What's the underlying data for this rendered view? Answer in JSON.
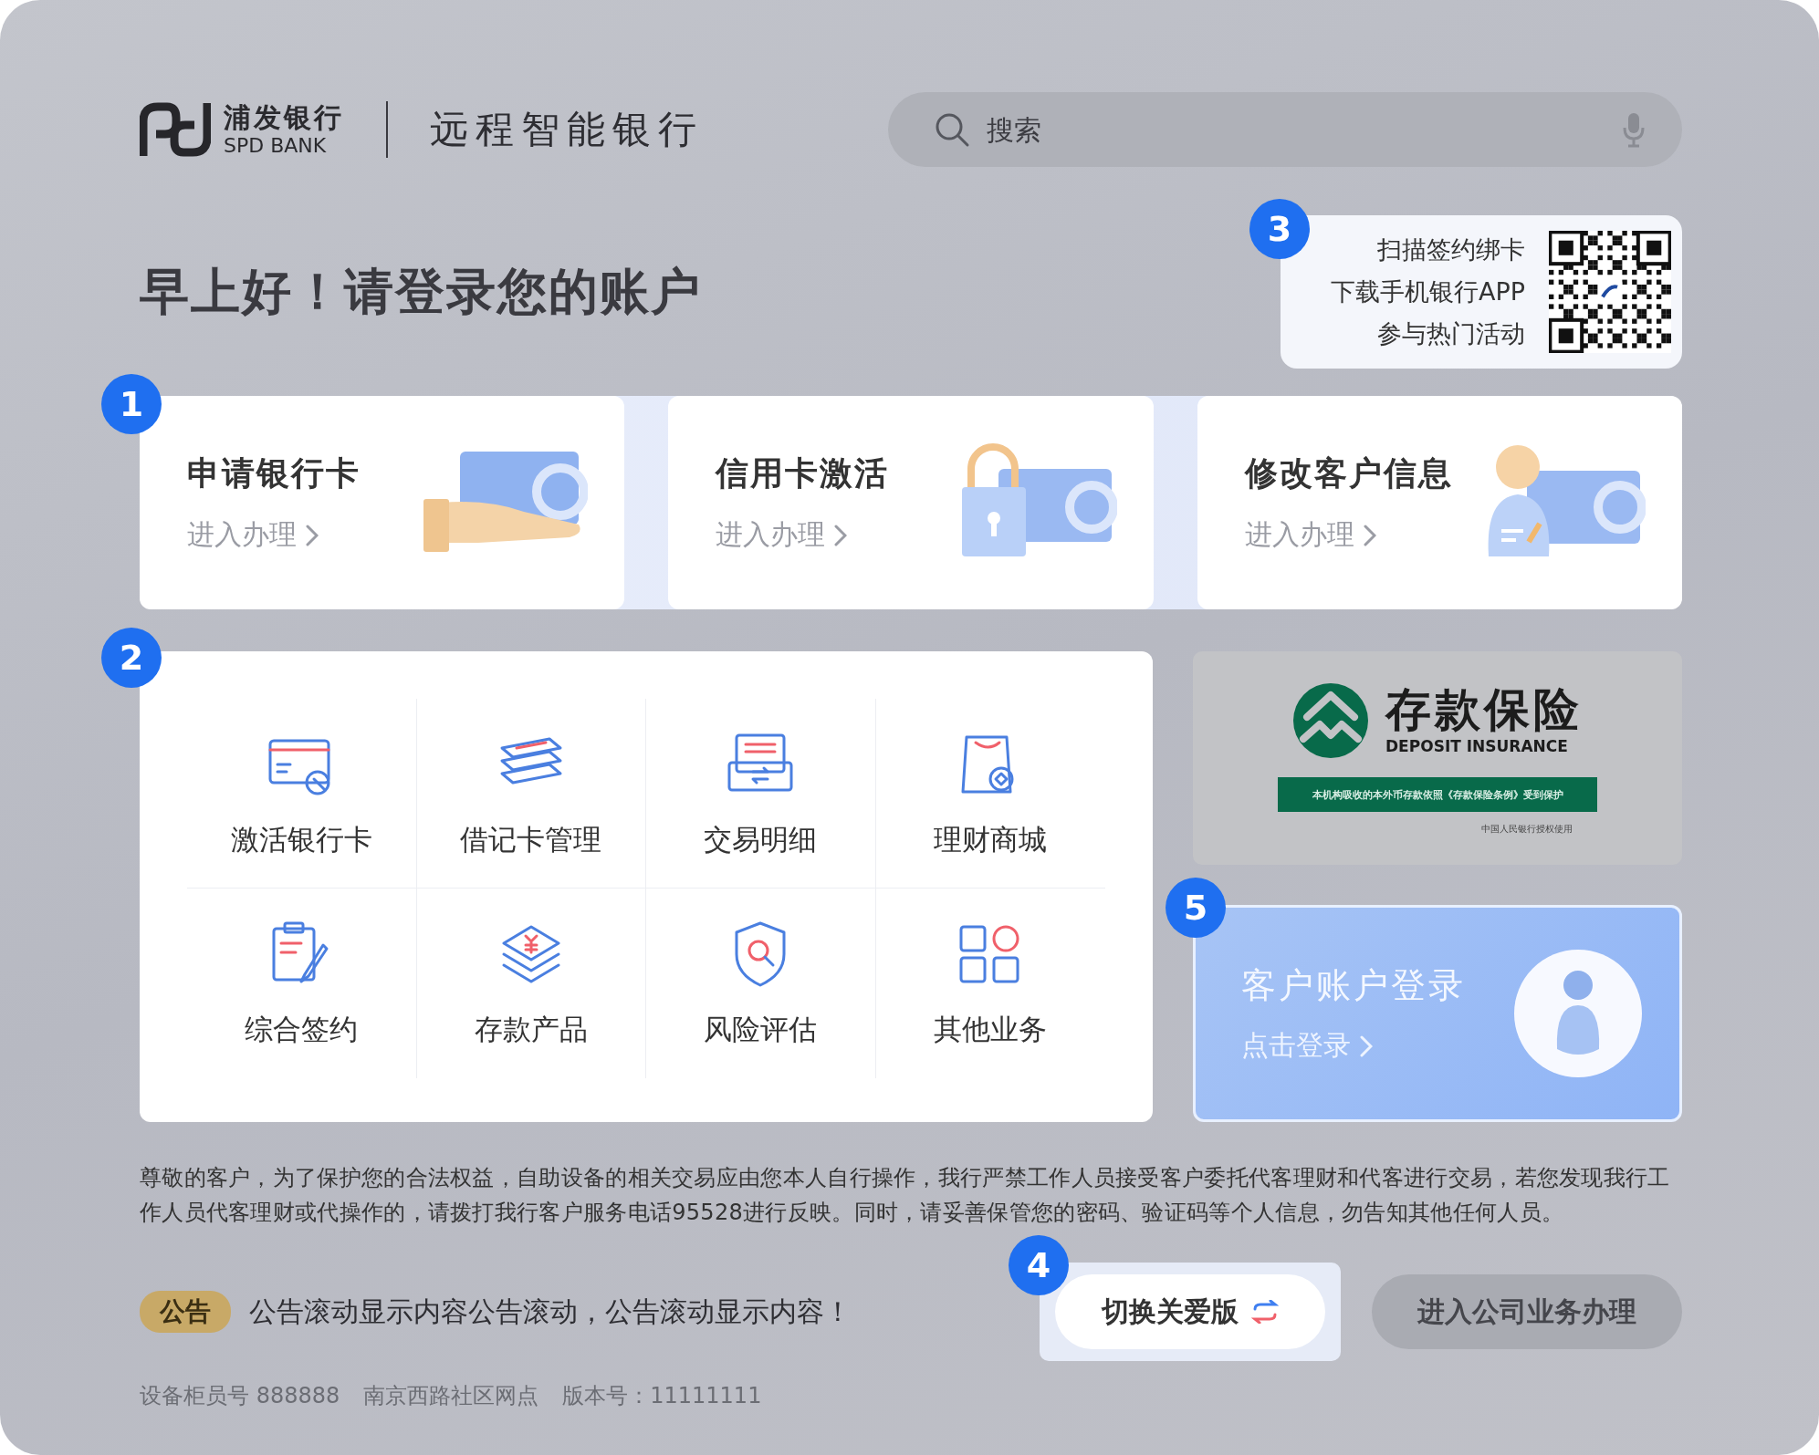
{
  "header": {
    "logo_name": "浦发银行",
    "logo_sub": "SPD BANK",
    "title": "远程智能银行"
  },
  "search": {
    "placeholder": "搜索"
  },
  "greeting": "早上好！请登录您的账户",
  "qr_card": {
    "badge": "3",
    "lines": [
      "扫描签约绑卡",
      "下载手机银行APP",
      "参与热门活动"
    ]
  },
  "quick_cards": {
    "badge": "1",
    "items": [
      {
        "title": "申请银行卡",
        "action": "进入办理",
        "kind": "card"
      },
      {
        "title": "信用卡激活",
        "action": "进入办理",
        "kind": "lock"
      },
      {
        "title": "修改客户信息",
        "action": "进入办理",
        "kind": "person"
      }
    ]
  },
  "services": {
    "badge": "2",
    "items": [
      {
        "label": "激活银行卡",
        "kind": "activate"
      },
      {
        "label": "借记卡管理",
        "kind": "cards"
      },
      {
        "label": "交易明细",
        "kind": "details"
      },
      {
        "label": "理财商城",
        "kind": "mall"
      },
      {
        "label": "综合签约",
        "kind": "sign"
      },
      {
        "label": "存款产品",
        "kind": "deposit"
      },
      {
        "label": "风险评估",
        "kind": "risk"
      },
      {
        "label": "其他业务",
        "kind": "other"
      }
    ]
  },
  "deposit_insurance": {
    "title": "存款保险",
    "subtitle": "DEPOSIT INSURANCE",
    "banner": "本机构吸收的本外币存款依照《存款保险条例》受到保护",
    "note": "中国人民银行授权使用"
  },
  "login_card": {
    "badge": "5",
    "title": "客户账户登录",
    "action": "点击登录"
  },
  "notice": "尊敬的客户，为了保护您的合法权益，自助设备的相关交易应由您本人自行操作，我行严禁工作人员接受客户委托代客理财和代客进行交易，若您发现我行工作人员代客理财或代操作的，请拨打我行客户服务电话95528进行反映。同时，请妥善保管您的密码、验证码等个人信息，勿告知其他任何人员。",
  "announcement": {
    "tag": "公告",
    "text": "公告滚动显示内容公告滚动，公告滚动显示内容！"
  },
  "buttons": [
    {
      "label": "切换关爱版",
      "kind": "care",
      "badge": "4"
    },
    {
      "label": "进入公司业务办理",
      "kind": "plain"
    }
  ],
  "footer": [
    "设备柜员号 888888",
    "南京西路社区网点",
    "版本号：11111111"
  ]
}
